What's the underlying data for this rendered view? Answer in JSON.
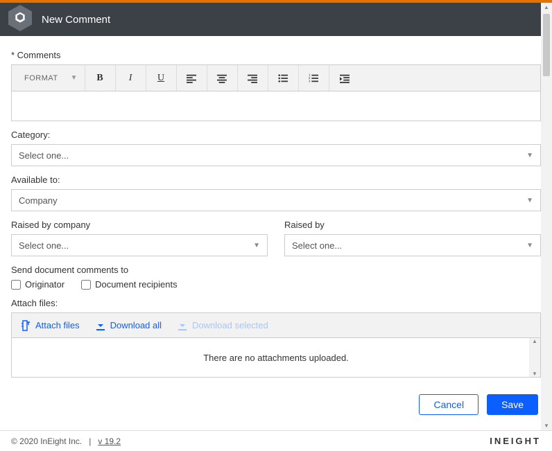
{
  "header": {
    "title": "New Comment"
  },
  "comments": {
    "label": "* Comments",
    "format_label": "FORMAT"
  },
  "category": {
    "label": "Category:",
    "selected": "Select one..."
  },
  "available_to": {
    "label": "Available to:",
    "selected": "Company"
  },
  "raised_by_company": {
    "label": "Raised by company",
    "selected": "Select one..."
  },
  "raised_by": {
    "label": "Raised by",
    "selected": "Select one..."
  },
  "send_to": {
    "label": "Send document comments to",
    "originator": "Originator",
    "recipients": "Document recipients"
  },
  "attach": {
    "label": "Attach files:",
    "attach_btn": "Attach files",
    "download_all": "Download all",
    "download_selected": "Download selected",
    "empty_text": "There are no attachments uploaded."
  },
  "buttons": {
    "cancel": "Cancel",
    "save": "Save"
  },
  "footer": {
    "copyright": "© 2020 InEight Inc.",
    "divider": "|",
    "version": "v 19.2",
    "brand": "INEIGHT"
  }
}
